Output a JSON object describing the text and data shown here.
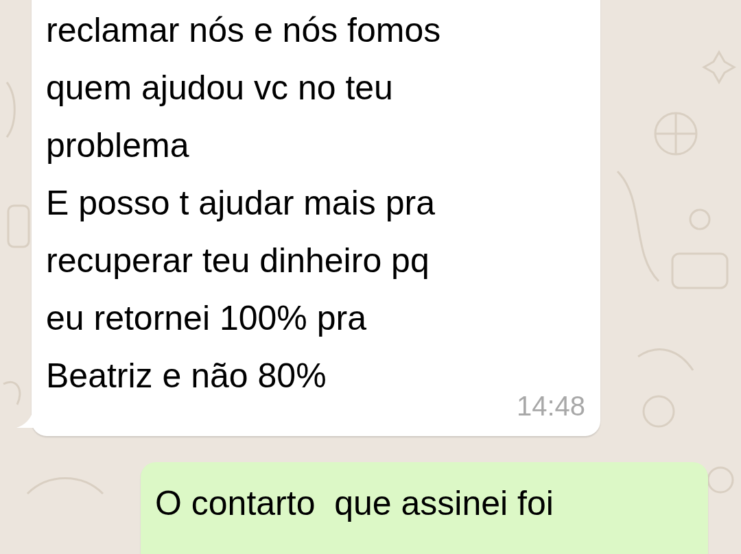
{
  "messages": [
    {
      "kind": "incoming",
      "text": "reclamar nós e nós fomos\nquem ajudou vc no teu\nproblema\nE posso t ajudar mais pra\nrecuperar teu dinheiro pq\neu retornei 100% pra\nBeatriz e não 80%",
      "time": "14:48"
    },
    {
      "kind": "outgoing",
      "text": "O contarto  que assinei foi"
    }
  ]
}
